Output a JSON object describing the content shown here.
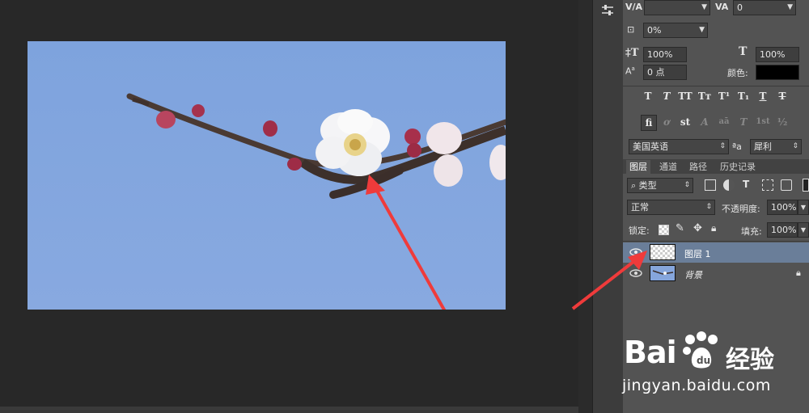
{
  "character_panel": {
    "kerning_value": "",
    "tracking_value": "0",
    "scale_percent": "0%",
    "vertical_scale": "100%",
    "horizontal_scale": "100%",
    "baseline_shift": "0 点",
    "color_label": "颜色:",
    "color_swatch": "#000000",
    "type_styles": [
      "T",
      "T",
      "TT",
      "Tт",
      "T¹",
      "T₁",
      "T",
      "T"
    ],
    "opentype_features": [
      "fi",
      "ơ",
      "st",
      "A",
      "aā",
      "T",
      "1st",
      "½"
    ],
    "language": "美国英语",
    "aa_icon": "ªa",
    "antialias": "犀利"
  },
  "layers_panel": {
    "tabs": [
      "图层",
      "通道",
      "路径",
      "历史记录"
    ],
    "filter_kind": "类型",
    "blend_mode": "正常",
    "opacity_label": "不透明度:",
    "opacity_value": "100%",
    "lock_label": "锁定:",
    "fill_label": "填充:",
    "fill_value": "100%",
    "layers": [
      {
        "name": "图层 1",
        "visible": true,
        "selected": true,
        "thumbnail": "transparent"
      },
      {
        "name": "背景",
        "visible": true,
        "selected": false,
        "thumbnail": "photo",
        "locked": true
      }
    ]
  },
  "watermark": {
    "brand_left": "Bai",
    "brand_right": "经验",
    "url": "jingyan.baidu.com"
  },
  "colors": {
    "panel_bg": "#535353",
    "workspace_bg": "#282828",
    "selected_layer": "#6a7e99",
    "sky": "#85a7df",
    "arrow_red": "#ef3b3b"
  }
}
